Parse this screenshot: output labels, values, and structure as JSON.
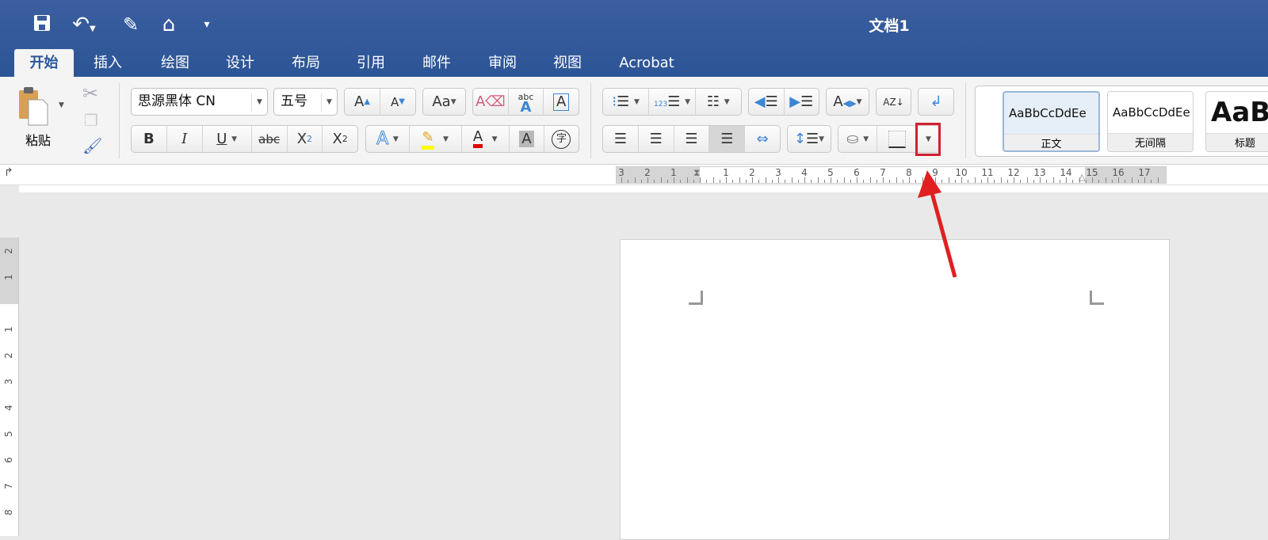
{
  "window": {
    "title": "文档1"
  },
  "quick_access": {
    "icons": [
      "save-icon",
      "undo-icon",
      "edit-icon",
      "home-icon",
      "customize-icon"
    ]
  },
  "tabs": [
    "开始",
    "插入",
    "绘图",
    "设计",
    "布局",
    "引用",
    "邮件",
    "审阅",
    "视图",
    "Acrobat"
  ],
  "clipboard": {
    "paste_label": "粘贴"
  },
  "font": {
    "name": "思源黑体 CN",
    "size": "五号",
    "grow": "A",
    "shrink": "A",
    "change_case": "Aa",
    "phonetic": "abc",
    "border": "A",
    "bold": "B",
    "italic": "I",
    "underline": "U",
    "strike": "abc",
    "sub": "X",
    "sub_n": "2",
    "sup": "X",
    "sup_n": "2",
    "effects": "A",
    "font_color": "A",
    "shading": "A",
    "enclose": "字",
    "highlight_color": "#ffff00",
    "font_color_value": "#e00000"
  },
  "styles": [
    {
      "preview": "AaBbCcDdEe",
      "name": "正文",
      "selected": true
    },
    {
      "preview": "AaBbCcDdEe",
      "name": "无间隔"
    },
    {
      "preview": "AaB",
      "name": "标题"
    }
  ],
  "ruler": {
    "top": [
      "3",
      "2",
      "1",
      "1",
      "2",
      "3",
      "4",
      "5",
      "6",
      "7",
      "8",
      "9",
      "10",
      "11",
      "12",
      "13",
      "14",
      "15",
      "16",
      "17"
    ],
    "left": [
      "2",
      "1",
      "1",
      "2",
      "3",
      "4",
      "5",
      "6",
      "7",
      "8"
    ]
  },
  "annotation": {
    "color": "#e02020"
  }
}
